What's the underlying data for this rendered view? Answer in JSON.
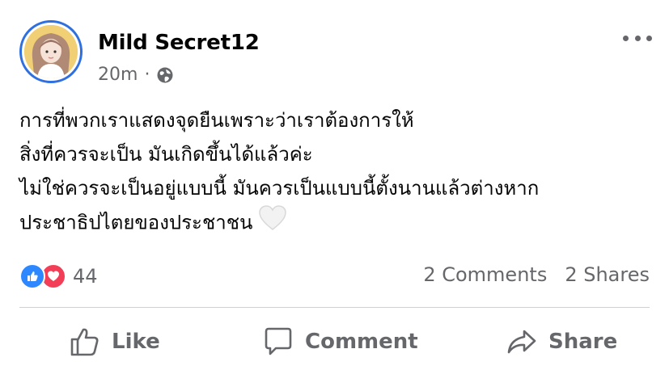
{
  "post": {
    "author": "Mild Secret12",
    "time": "20m",
    "separator": "·",
    "privacy_icon": "globe-icon",
    "lines": [
      "การที่พวกเราแสดงจุดยืนเพราะว่าเราต้องการให้",
      "สิ่งที่ควรจะเป็น มันเกิดขึ้นได้แล้วค่ะ",
      "ไม่ใช่ควรจะเป็นอยู่แบบนี้ มันควรเป็นแบบนี้ตั้งนานแล้วต่างหาก",
      "ประชาธิปไตยของประชาชน"
    ],
    "emoji": "white-heart"
  },
  "reactions": {
    "count": "44",
    "icons": [
      "like-icon",
      "love-icon"
    ]
  },
  "stats": {
    "comments": "2 Comments",
    "shares": "2 Shares"
  },
  "actions": {
    "like": "Like",
    "comment": "Comment",
    "share": "Share"
  },
  "colors": {
    "brand_blue": "#2d88ff",
    "love_red": "#f33e58",
    "muted_text": "#65676b",
    "avatar_ring": "#2f6fe0"
  }
}
